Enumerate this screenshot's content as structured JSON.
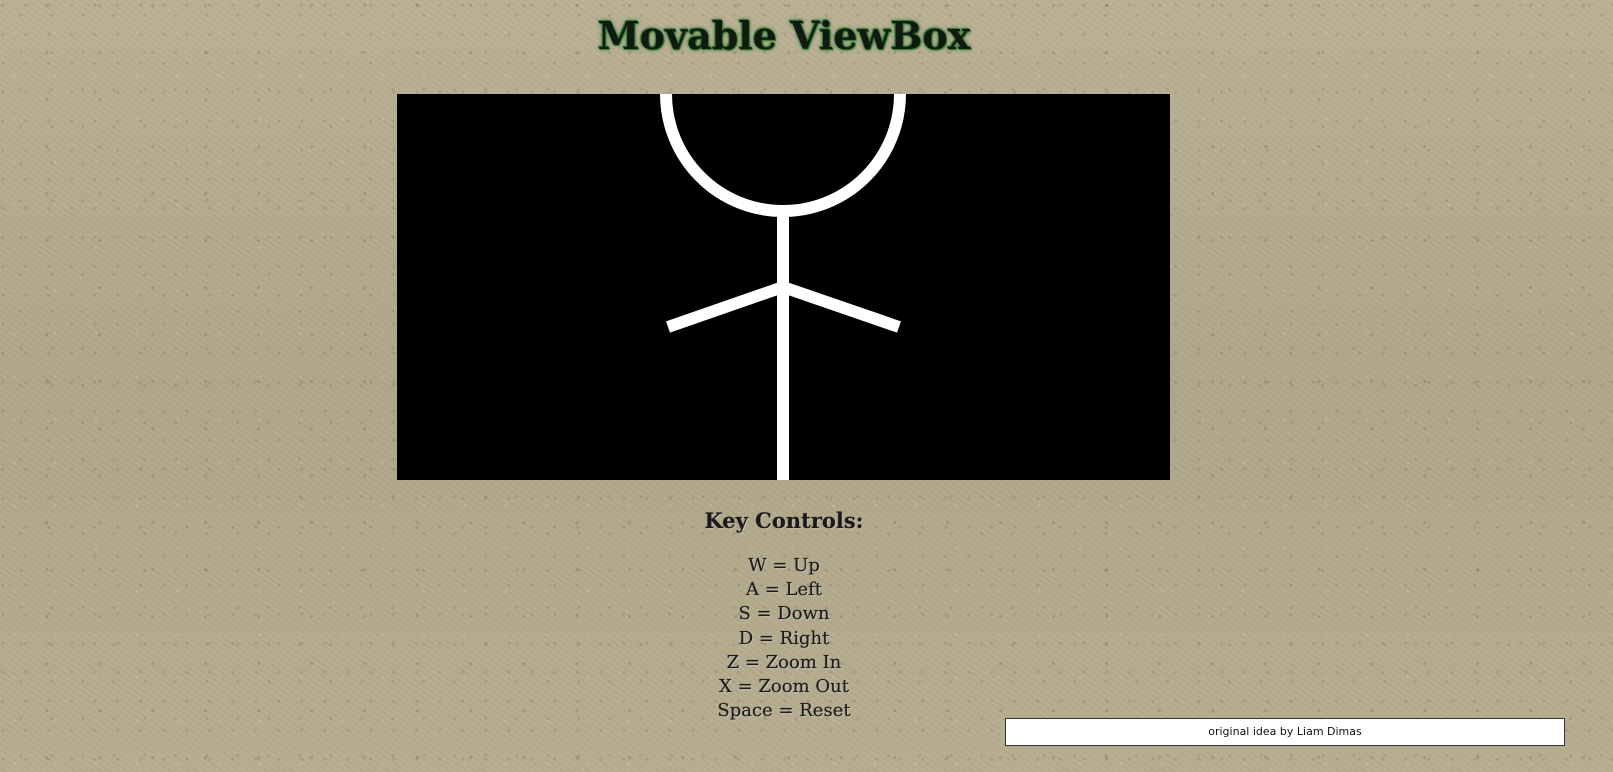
{
  "page": {
    "title": "Movable ViewBox"
  },
  "controls": {
    "heading": "Key Controls:",
    "items": [
      "W = Up",
      "A = Left",
      "S = Down",
      "D = Right",
      "Z = Zoom In",
      "X = Zoom Out",
      "Space = Reset"
    ]
  },
  "footer": {
    "credit": "original idea by Liam Dimas"
  },
  "colors": {
    "stage_background": "#000000",
    "stick_figure": "#ffffff",
    "title_glow": "#3a7d3a"
  }
}
